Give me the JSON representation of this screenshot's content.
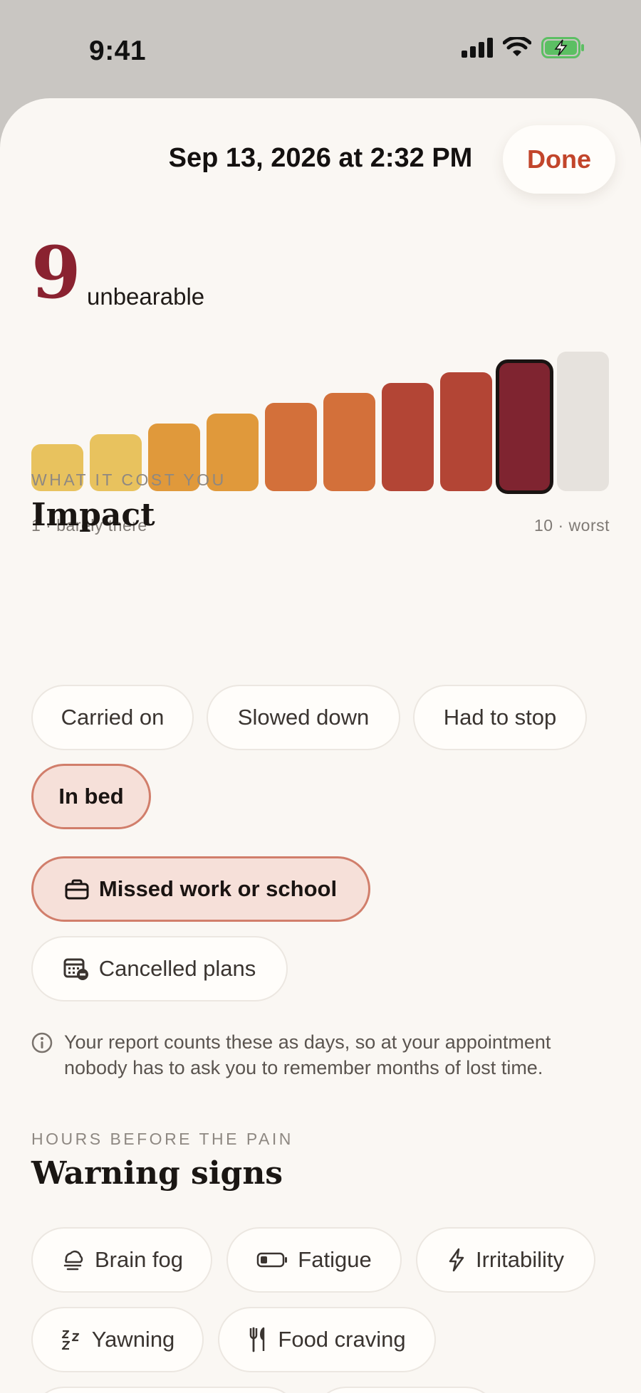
{
  "status_bar": {
    "time": "9:41"
  },
  "header": {
    "date": "Sep 13, 2026 at 2:32 PM",
    "done_label": "Done"
  },
  "severity": {
    "value": "9",
    "label": "unbearable",
    "selected": 9,
    "scale_min_label": "1 · barely there",
    "scale_max_label": "10 · worst",
    "levels": [
      {
        "level": 1,
        "color": "#e8c25e"
      },
      {
        "level": 2,
        "color": "#e8c25e"
      },
      {
        "level": 3,
        "color": "#e0993b"
      },
      {
        "level": 4,
        "color": "#e0993b"
      },
      {
        "level": 5,
        "color": "#d3703a"
      },
      {
        "level": 6,
        "color": "#d3703a"
      },
      {
        "level": 7,
        "color": "#b34535"
      },
      {
        "level": 8,
        "color": "#b34535"
      },
      {
        "level": 9,
        "color": "#7f2430"
      },
      {
        "level": 10,
        "color": "#e6e2dd"
      }
    ]
  },
  "impact": {
    "eyebrow": "WHAT IT COST YOU",
    "title": "Impact",
    "options": [
      {
        "label": "Carried on",
        "selected": false
      },
      {
        "label": "Slowed down",
        "selected": false
      },
      {
        "label": "Had to stop",
        "selected": false
      },
      {
        "label": "In bed",
        "selected": true
      }
    ],
    "extras": [
      {
        "label": "Missed work or school",
        "icon": "briefcase-icon",
        "selected": true
      },
      {
        "label": "Cancelled plans",
        "icon": "calendar-cancel-icon",
        "selected": false
      }
    ],
    "info_text": "Your report counts these as days, so at your appointment nobody has to ask you to remember months of lost time."
  },
  "warning_signs": {
    "eyebrow": "HOURS BEFORE THE PAIN",
    "title": "Warning signs",
    "options": [
      {
        "label": "Brain fog",
        "icon": "cloud-fog-icon"
      },
      {
        "label": "Fatigue",
        "icon": "battery-low-icon"
      },
      {
        "label": "Irritability",
        "icon": "bolt-icon"
      },
      {
        "label": "Yawning",
        "icon": "zzz-icon"
      },
      {
        "label": "Food craving",
        "icon": "fork-knife-icon"
      }
    ]
  },
  "colors": {
    "accent": "#c2452b",
    "selected_fill": "#f6e0d9",
    "selected_border": "#d17e6b",
    "score": "#8a2230"
  }
}
